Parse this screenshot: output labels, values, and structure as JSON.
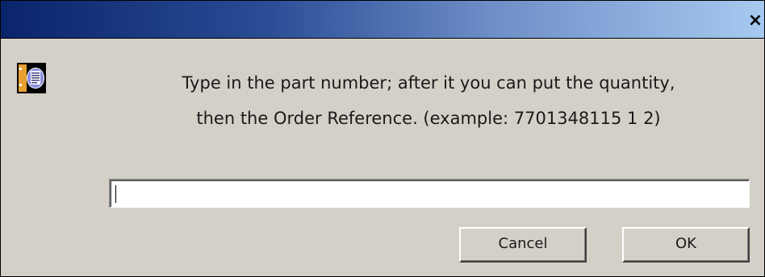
{
  "title_bar": {
    "close_label": "×"
  },
  "dialog": {
    "icon": "info-document-icon",
    "message_line1": "Type in the part number; after it you can put the quantity,",
    "message_line2": "then the Order Reference. (example: 7701348115 1 2)",
    "input_value": ""
  },
  "buttons": {
    "cancel_label": "Cancel",
    "ok_label": "OK"
  },
  "colors": {
    "title_gradient_start": "#0a246a",
    "title_gradient_end": "#a6caf0",
    "dialog_bg": "#d4d0c8"
  }
}
